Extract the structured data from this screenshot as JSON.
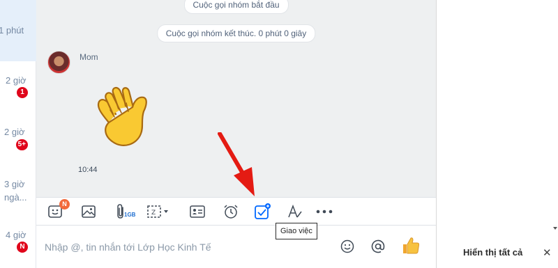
{
  "conversation_list": [
    {
      "time": "1 phút",
      "badge": "",
      "active": true
    },
    {
      "time": "2 giờ",
      "badge": "1"
    },
    {
      "time": "2 giờ",
      "badge": "5+"
    },
    {
      "time": "3 giờ\nngà...",
      "badge": ""
    },
    {
      "time": "4 giờ",
      "badge": "N"
    }
  ],
  "chat": {
    "system_messages": [
      "Cuộc gọi nhóm bắt đầu",
      "Cuộc gọi nhóm kết thúc. 0 phút 0 giây"
    ],
    "sender_name": "Mom",
    "message_time": "10:44"
  },
  "toolbar": {
    "sticker_badge": "N",
    "file_size_label": "1GB",
    "tooltip": "Giao việc"
  },
  "composer": {
    "placeholder": "Nhập @, tin nhắn tới Lớp Học Kinh Tế"
  },
  "right_panel": {
    "show_all_label": "Hiển thị tất cả",
    "close_glyph": "✕"
  },
  "colors": {
    "accent": "#0068ff",
    "badge_red": "#e0061b",
    "badge_orange": "#f26a3b",
    "annotation_arrow": "#e41b13"
  }
}
